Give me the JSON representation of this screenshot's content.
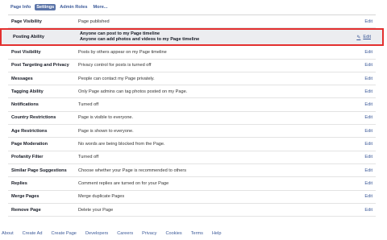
{
  "tabs": [
    {
      "label": "Page Info",
      "active": false
    },
    {
      "label": "Settings",
      "active": true
    },
    {
      "label": "Admin Roles",
      "active": false
    },
    {
      "label": "More...",
      "active": false
    }
  ],
  "edit_label": "Edit",
  "rows": [
    {
      "label": "Page Visibility",
      "value": "Page published"
    },
    {
      "label": "Posting Ability",
      "value_line1": "Anyone can post to my Page timeline",
      "value_line2": "Anyone can add photos and videos to my Page timeline"
    },
    {
      "label": "Post Visibility",
      "value": "Posts by others appear on my Page timeline"
    },
    {
      "label": "Post Targeting and Privacy",
      "value": "Privacy control for posts is turned off"
    },
    {
      "label": "Messages",
      "value": "People can contact my Page privately."
    },
    {
      "label": "Tagging Ability",
      "value": "Only Page admins can tag photos posted on my Page."
    },
    {
      "label": "Notifications",
      "value": "Turned off"
    },
    {
      "label": "Country Restrictions",
      "value": "Page is visible to everyone."
    },
    {
      "label": "Age Restrictions",
      "value": "Page is shown to everyone."
    },
    {
      "label": "Page Moderation",
      "value": "No words are being blocked from the Page."
    },
    {
      "label": "Profanity Filter",
      "value": "Turned off"
    },
    {
      "label": "Similar Page Suggestions",
      "value": "Choose whether your Page is recommended to others"
    },
    {
      "label": "Replies",
      "value": "Comment replies are turned on for your Page"
    },
    {
      "label": "Merge Pages",
      "value": "Merge duplicate Pages"
    },
    {
      "label": "Remove Page",
      "value": "Delete your Page"
    }
  ],
  "footer": [
    "About",
    "Create Ad",
    "Create Page",
    "Developers",
    "Careers",
    "Privacy",
    "Cookies",
    "Terms",
    "Help"
  ],
  "colors": {
    "link": "#3b5998",
    "highlight_border": "#e3302f",
    "highlight_bg": "#ecedf0",
    "active_tab": "#5b74a8"
  },
  "icons": {
    "edit": "pencil-icon"
  }
}
